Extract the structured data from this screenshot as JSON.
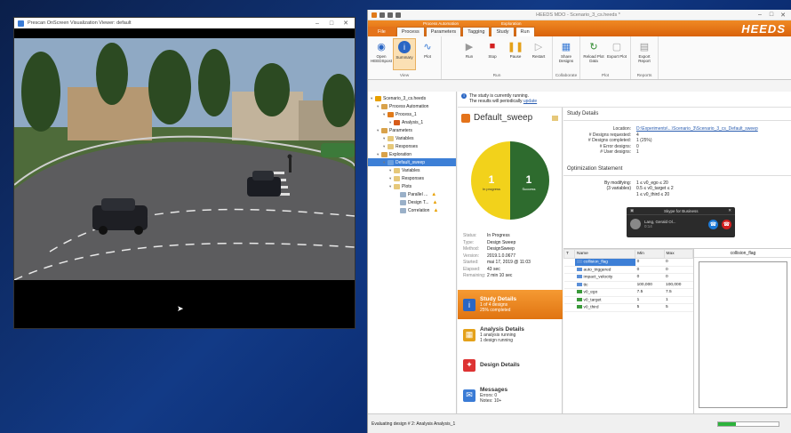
{
  "viewer": {
    "title": "Prescan OnScreen Visualization Viewer: default",
    "minimize": "–",
    "maximize": "□",
    "close": "✕"
  },
  "heeds": {
    "window_title": "HEEDS MDO - Scenario_3_cs.heeds *",
    "brand": "HEEDS",
    "context_labels": {
      "process_automation": "Process Automation",
      "exploration": "Exploration"
    },
    "tabs": [
      "File",
      "Process",
      "Parameters",
      "Tagging",
      "Study",
      "Run"
    ],
    "active_tab": "Run",
    "ribbon": {
      "groups": [
        {
          "label": "View",
          "buttons": [
            "Open HEEDSpost",
            "Summary",
            "Plot"
          ]
        },
        {
          "label": "Run",
          "buttons": [
            "Run",
            "Stop",
            "Pause",
            "Restart"
          ]
        },
        {
          "label": "Collaborate",
          "buttons": [
            "Share Designs"
          ]
        },
        {
          "label": "Plot",
          "buttons": [
            "Reload Plot Data",
            "Export Plot"
          ]
        },
        {
          "label": "Reports",
          "buttons": [
            "Export Report"
          ]
        }
      ]
    },
    "tree": [
      {
        "label": "Scenario_3_cs.heeds",
        "level": 0,
        "icon": "#e8a000"
      },
      {
        "label": "Process Automation",
        "level": 1,
        "icon": "#d9a24a"
      },
      {
        "label": "Process_1",
        "level": 2,
        "icon": "#e07a1a"
      },
      {
        "label": "Analysis_1",
        "level": 3,
        "icon": "#d65b1a"
      },
      {
        "label": "Parameters",
        "level": 1,
        "icon": "#d9a24a"
      },
      {
        "label": "Variables",
        "level": 2,
        "icon": "#e6c87a"
      },
      {
        "label": "Responses",
        "level": 2,
        "icon": "#e6c87a"
      },
      {
        "label": "Exploration",
        "level": 1,
        "icon": "#d9a24a"
      },
      {
        "label": "Default_sweep",
        "level": 2,
        "icon": "#6aa0e0",
        "selected": true
      },
      {
        "label": "Variables",
        "level": 3,
        "icon": "#e6c87a"
      },
      {
        "label": "Responses",
        "level": 3,
        "icon": "#e6c87a"
      },
      {
        "label": "Plots",
        "level": 3,
        "icon": "#e6c87a"
      },
      {
        "label": "Parallel ...",
        "level": 4,
        "icon": "#9ab0c8",
        "warn": true
      },
      {
        "label": "Design T...",
        "level": 4,
        "icon": "#9ab0c8",
        "warn": true
      },
      {
        "label": "Correlation",
        "level": 4,
        "icon": "#9ab0c8",
        "warn": true
      }
    ],
    "info": {
      "line1": "The study is currently running.",
      "line2": "The results will periodically",
      "link": "update"
    },
    "study": {
      "title": "Default_sweep",
      "pie": {
        "in_progress": 1,
        "success": 1,
        "in_progress_label": "In progress",
        "success_label": "Success",
        "in_progress_color": "#f2d21b",
        "success_color": "#2e6b2e"
      },
      "status": [
        {
          "k": "Status:",
          "v": "In Progress"
        },
        {
          "k": "Type:",
          "v": "Design Sweep"
        },
        {
          "k": "Method:",
          "v": "DesignSweep"
        },
        {
          "k": "Version:",
          "v": "2019.1.0.0677"
        },
        {
          "k": "Started:",
          "v": "mai 17, 2019 @ 11:03"
        },
        {
          "k": "Elapsed:",
          "v": "43 sec"
        },
        {
          "k": "Remaining:",
          "v": "2 min 10 sec"
        }
      ]
    },
    "side_nav": [
      {
        "title": "Study Details",
        "sub1": "1 of 4 designs",
        "sub2": "25% completed",
        "active": true
      },
      {
        "title": "Analysis Details",
        "sub1": "1 analysis running",
        "sub2": "1 design running"
      },
      {
        "title": "Design Details",
        "sub1": "",
        "sub2": ""
      },
      {
        "title": "Messages",
        "sub1": "Errors: 0",
        "sub2": "Notes: 10+"
      }
    ],
    "details": {
      "heading": "Study Details",
      "rows": [
        {
          "k": "Location:",
          "v": "D:\\Experiments\\...\\Scenario_3\\Scenario_3_cs_Default_sweep",
          "link": true
        },
        {
          "k": "# Designs requested:",
          "v": "4"
        },
        {
          "k": "# Designs completed:",
          "v": "1 (25%)"
        },
        {
          "k": "# Error designs:",
          "v": "0"
        },
        {
          "k": "# User designs:",
          "v": "1"
        }
      ],
      "opt_heading": "Optimization Statement",
      "opt_k1": "By modifying:",
      "opt_k2": "(3 variables)",
      "opt_v1": "1  ≤  v0_ego  ≤  20",
      "opt_v2": "0.5  ≤  v0_target  ≤  2",
      "opt_v3": "1  ≤  v0_third  ≤  20"
    },
    "skype": {
      "title": "Skype for Business",
      "caller": "Lang, Gerald Ol...",
      "time": "0:14"
    },
    "table": {
      "headers": [
        "Name",
        "Min",
        "Max"
      ],
      "rows": [
        {
          "name": "collision_flag",
          "min": "0",
          "max": "0",
          "selected": true
        },
        {
          "name": "auto_triggered",
          "min": "0",
          "max": "0"
        },
        {
          "name": "impact_velocity",
          "min": "0",
          "max": "0"
        },
        {
          "name": "ttc",
          "min": "100,000",
          "max": "100,000"
        },
        {
          "name": "v0_ego",
          "min": "7.5",
          "max": "7.5"
        },
        {
          "name": "v0_target",
          "min": "1",
          "max": "1"
        },
        {
          "name": "v0_third",
          "min": "5",
          "max": "5"
        }
      ]
    },
    "plot": {
      "title": "collision_flag"
    },
    "statusbar": {
      "text": "Evaluating design # 2: Analysis Analysis_1",
      "progress": 0.3
    }
  }
}
